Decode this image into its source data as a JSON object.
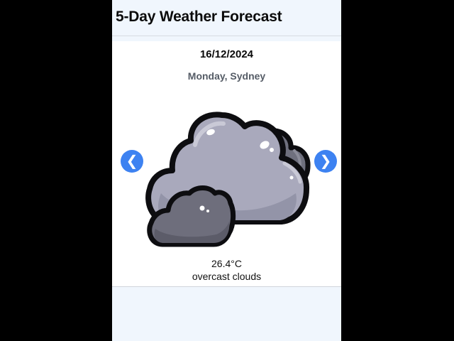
{
  "app": {
    "title": "5-Day Weather Forecast"
  },
  "forecast": {
    "date": "16/12/2024",
    "day_location": "Monday, Sydney",
    "temperature": "26.4°C",
    "description": "overcast clouds",
    "icon": "overcast-clouds-icon"
  },
  "navigation": {
    "prev_label": "❮",
    "next_label": "❯"
  },
  "colors": {
    "page_background": "#f0f6fd",
    "card_background": "#ffffff",
    "nav_button": "#3d82f1",
    "cloud_light": "#a9a9bc",
    "cloud_dark": "#6e6e7c"
  }
}
